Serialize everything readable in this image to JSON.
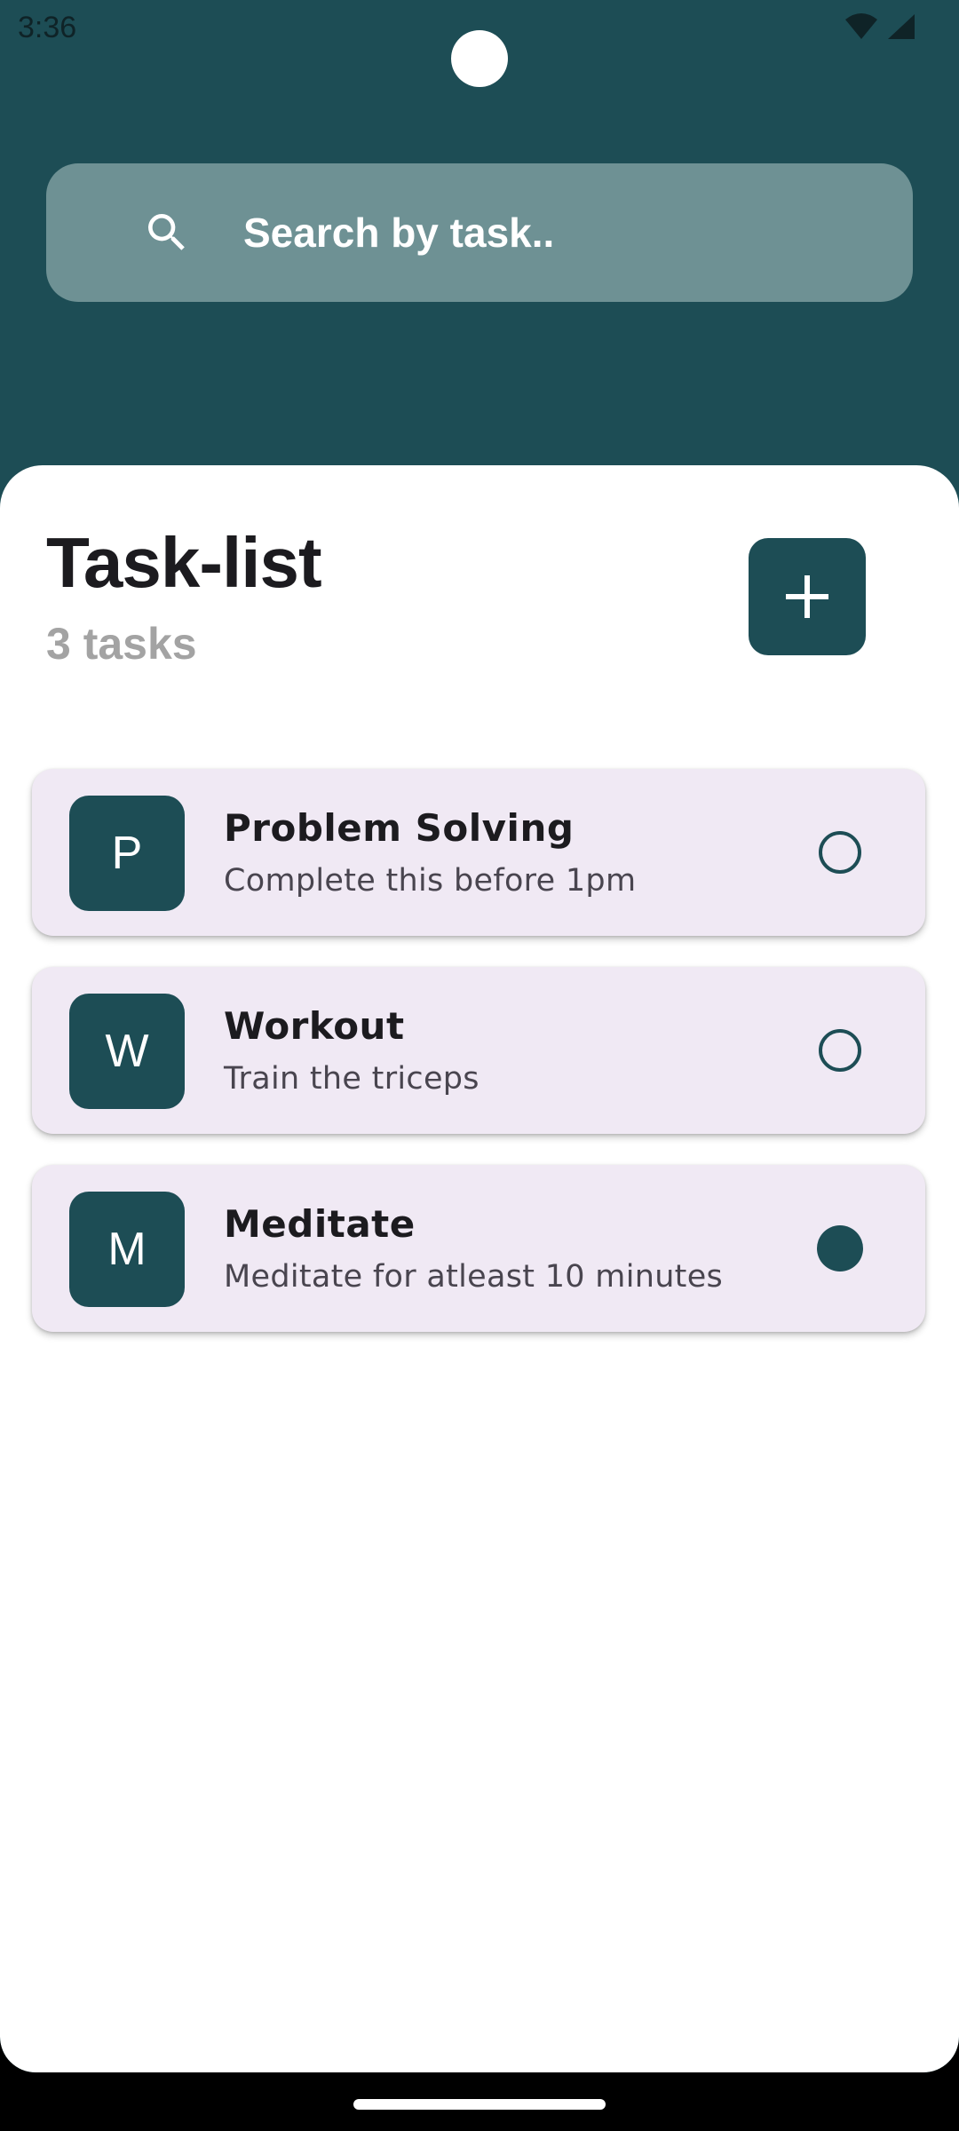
{
  "status_bar": {
    "time": "3:36"
  },
  "search": {
    "placeholder": "Search by task.."
  },
  "header": {
    "title": "Task-list",
    "count": "3 tasks"
  },
  "tasks": [
    {
      "initial": "P",
      "title": "Problem Solving",
      "subtitle": "Complete this before 1pm",
      "done": false
    },
    {
      "initial": "W",
      "title": "Workout",
      "subtitle": "Train the triceps",
      "done": false
    },
    {
      "initial": "M",
      "title": "Meditate",
      "subtitle": "Meditate for atleast 10 minutes",
      "done": true
    }
  ],
  "colors": {
    "primary": "#1D4D55",
    "search_bg": "#6E9194",
    "card_bg": "#F0E9F4",
    "muted_text": "#A3A3A3"
  },
  "icons": {
    "search": "search-icon",
    "add": "plus-icon",
    "wifi": "wifi-icon",
    "signal": "signal-icon"
  }
}
